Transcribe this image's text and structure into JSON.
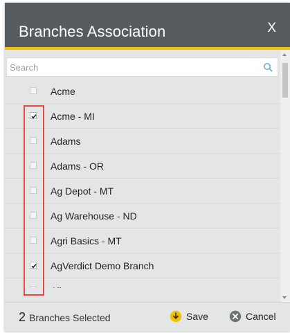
{
  "dialog": {
    "title": "Branches Association",
    "close_label": "X"
  },
  "search": {
    "placeholder": "Search",
    "value": "",
    "icon": "search-icon"
  },
  "branches": [
    {
      "label": "Acme",
      "checked": false
    },
    {
      "label": "Acme - MI",
      "checked": true
    },
    {
      "label": "Adams",
      "checked": false
    },
    {
      "label": "Adams - OR",
      "checked": false
    },
    {
      "label": "Ag Depot - MT",
      "checked": false
    },
    {
      "label": "Ag Warehouse - ND",
      "checked": false
    },
    {
      "label": "Agri Basics - MT",
      "checked": false
    },
    {
      "label": "AgVerdict Demo Branch",
      "checked": true
    },
    {
      "label": "Albany",
      "checked": false
    }
  ],
  "footer": {
    "selected_count": "2",
    "selected_text": "Branches Selected",
    "save_label": "Save",
    "cancel_label": "Cancel"
  },
  "colors": {
    "titlebar": "#555b5f",
    "accent": "#f2c200",
    "highlight_box": "#e8483f",
    "save_icon": "#f2c200",
    "cancel_icon": "#6e7376"
  }
}
